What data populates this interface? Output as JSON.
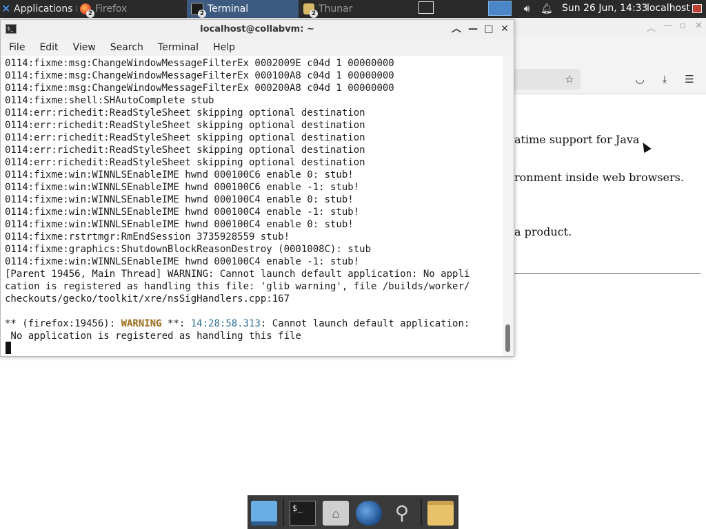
{
  "top_panel": {
    "apps_menu_label": "Applications",
    "apps_menu_sep": "⁝",
    "tasks": [
      {
        "label": "Firefox",
        "badge": "2"
      },
      {
        "label": "Terminal",
        "badge": "2"
      },
      {
        "label": "Thunar",
        "badge": "2"
      }
    ],
    "clock": "Sun 26 Jun, 14:33",
    "hostname": "localhost"
  },
  "firefox_bg": {
    "content_fragments": [
      "atime support for Java",
      "ronment inside web browsers.",
      "a product."
    ]
  },
  "terminal": {
    "title": "localhost@collabvm: ~",
    "menu": [
      "File",
      "Edit",
      "View",
      "Search",
      "Terminal",
      "Help"
    ],
    "lines": [
      "0114:fixme:msg:ChangeWindowMessageFilterEx 0002009E c04d 1 00000000",
      "0114:fixme:msg:ChangeWindowMessageFilterEx 000100A8 c04d 1 00000000",
      "0114:fixme:msg:ChangeWindowMessageFilterEx 000200A8 c04d 1 00000000",
      "0114:fixme:shell:SHAutoComplete stub",
      "0114:err:richedit:ReadStyleSheet skipping optional destination",
      "0114:err:richedit:ReadStyleSheet skipping optional destination",
      "0114:err:richedit:ReadStyleSheet skipping optional destination",
      "0114:err:richedit:ReadStyleSheet skipping optional destination",
      "0114:err:richedit:ReadStyleSheet skipping optional destination",
      "0114:fixme:win:WINNLSEnableIME hwnd 000100C6 enable 0: stub!",
      "0114:fixme:win:WINNLSEnableIME hwnd 000100C6 enable -1: stub!",
      "0114:fixme:win:WINNLSEnableIME hwnd 000100C4 enable 0: stub!",
      "0114:fixme:win:WINNLSEnableIME hwnd 000100C4 enable -1: stub!",
      "0114:fixme:win:WINNLSEnableIME hwnd 000100C4 enable 0: stub!",
      "0114:fixme:rstrtmgr:RmEndSession 3735928559 stub!",
      "0114:fixme:graphics:ShutdownBlockReasonDestroy (0001008C): stub",
      "0114:fixme:win:WINNLSEnableIME hwnd 000100C4 enable -1: stub!",
      "[Parent 19456, Main Thread] WARNING: Cannot launch default application: No appli",
      "cation is registered as handling this file: 'glib warning', file /builds/worker/",
      "checkouts/gecko/toolkit/xre/nsSigHandlers.cpp:167",
      ""
    ],
    "warning_line": {
      "prefix": "** (firefox:19456): ",
      "tag": "WARNING",
      "mid": " **: ",
      "timestamp": "14:28:58.313",
      "rest": ": Cannot launch default application:"
    },
    "last_line": " No application is registered as handling this file"
  },
  "dock": {
    "items": [
      "desktop",
      "terminal",
      "home-folder",
      "web-browser",
      "app-finder",
      "file-manager"
    ]
  }
}
